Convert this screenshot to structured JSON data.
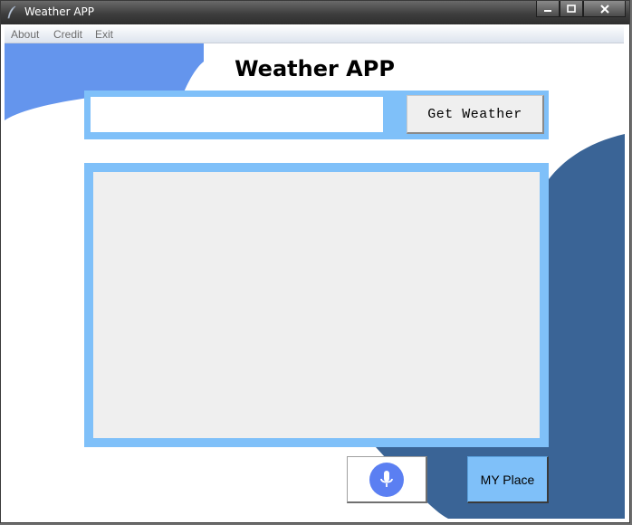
{
  "window": {
    "title": "Weather APP"
  },
  "menu": {
    "items": [
      "About",
      "Credit",
      "Exit"
    ]
  },
  "main": {
    "heading": "Weather APP",
    "city_input_value": "",
    "get_weather_label": "Get Weather",
    "result_text": "",
    "my_place_label": "MY Place"
  },
  "icons": {
    "app": "feather-icon",
    "minimize": "minimize-icon",
    "maximize": "maximize-icon",
    "close": "close-icon",
    "mic": "microphone-icon"
  },
  "colors": {
    "frame_blue": "#7fc0f9",
    "light_wave": "#6495ed",
    "dark_wave": "#3a6496",
    "mic_blue": "#5b7ff2",
    "panel_gray": "#efefef"
  }
}
